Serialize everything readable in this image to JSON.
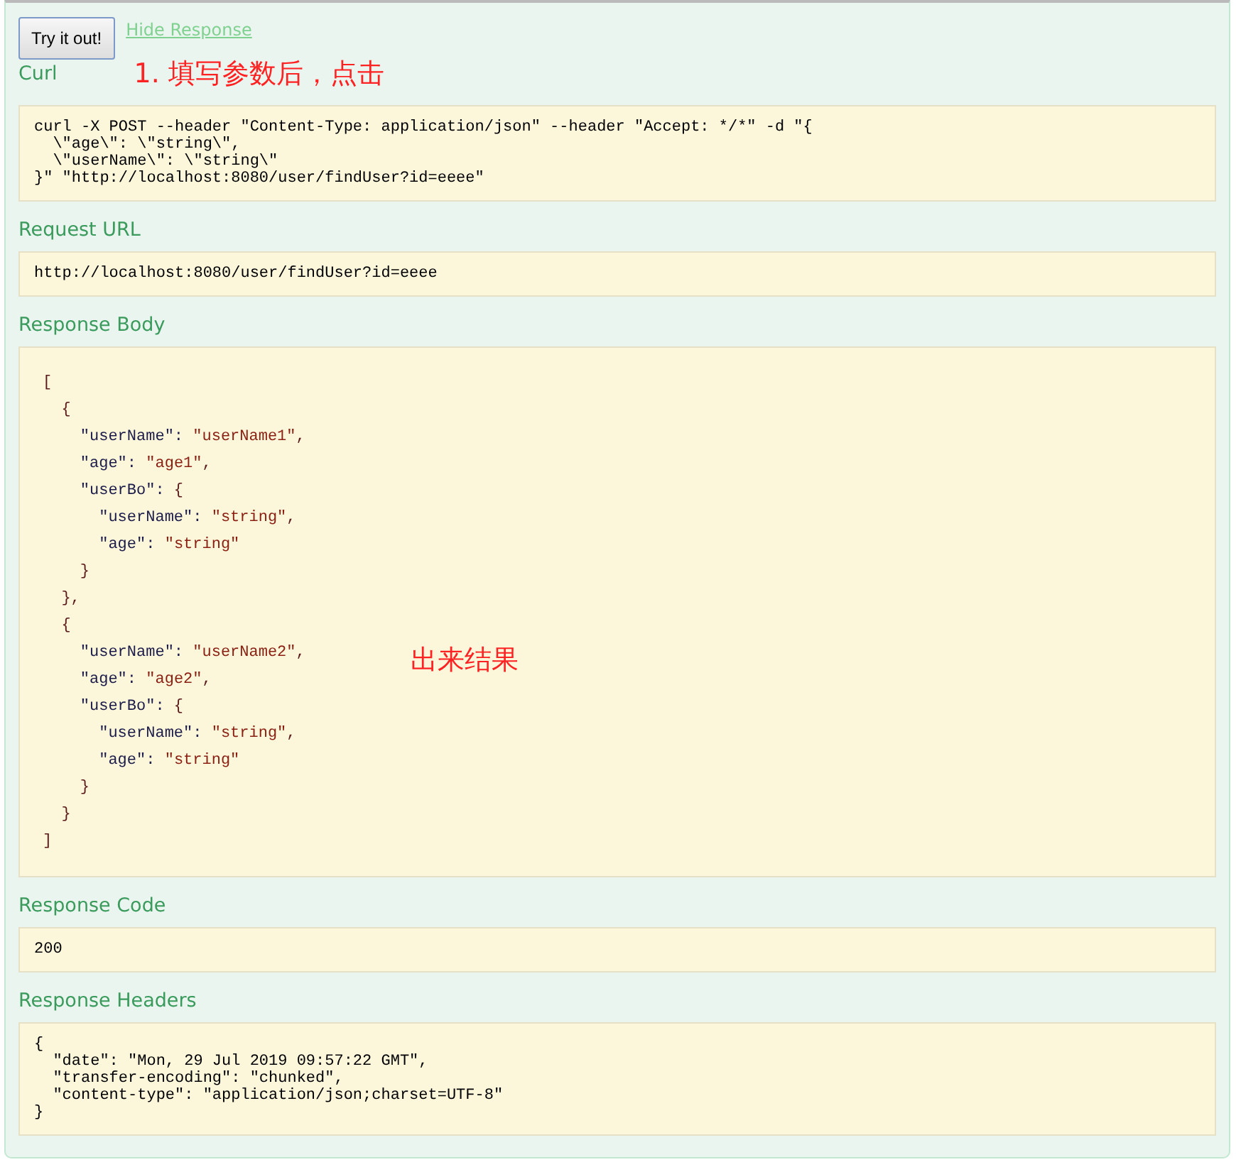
{
  "actions": {
    "button": "Try it out!",
    "link": "Hide Response"
  },
  "sections": [
    {
      "title": "Curl",
      "kind": "plain",
      "annotation": "1. 填写参数后，点击",
      "lines": [
        "curl -X POST --header \"Content-Type: application/json\" --header \"Accept: */*\" -d \"{",
        "  \\\"age\\\": \\\"string\\\",",
        "  \\\"userName\\\": \\\"string\\\"",
        "}\" \"http://localhost:8080/user/findUser?id=eeee\""
      ]
    },
    {
      "title": "Request URL",
      "kind": "plain",
      "lines": [
        "http://localhost:8080/user/findUser?id=eeee"
      ]
    },
    {
      "title": "Response Body",
      "kind": "json",
      "annotation": "出来结果",
      "lines": [
        "[",
        "  {",
        "    \"userName\": \"userName1\",",
        "    \"age\": \"age1\",",
        "    \"userBo\": {",
        "      \"userName\": \"string\",",
        "      \"age\": \"string\"",
        "    }",
        "  },",
        "  {",
        "    \"userName\": \"userName2\",",
        "    \"age\": \"age2\",",
        "    \"userBo\": {",
        "      \"userName\": \"string\",",
        "      \"age\": \"string\"",
        "    }",
        "  }",
        "]"
      ]
    },
    {
      "title": "Response Code",
      "kind": "plain",
      "lines": [
        "200"
      ]
    },
    {
      "title": "Response Headers",
      "kind": "plain",
      "lines": [
        "{",
        "  \"date\": \"Mon, 29 Jul 2019 09:57:22 GMT\",",
        "  \"transfer-encoding\": \"chunked\",",
        "  \"content-type\": \"application/json;charset=UTF-8\"",
        "}"
      ]
    }
  ]
}
